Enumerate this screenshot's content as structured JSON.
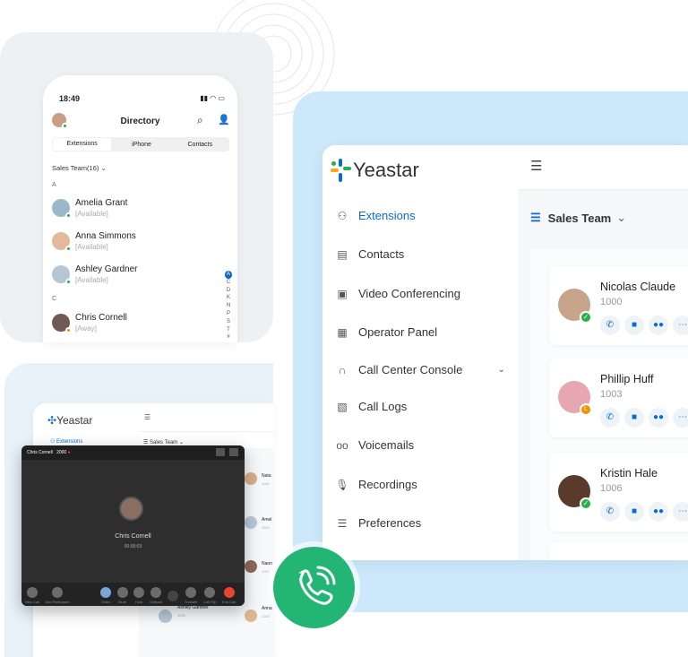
{
  "colors": {
    "accent": "#0b6bcb",
    "online": "#22b14c",
    "away": "#f39000",
    "call_green": "#22b573",
    "end_call": "#e8442f"
  },
  "phone": {
    "time": "18:49",
    "title": "Directory",
    "tabs": [
      "Extensions",
      "iPhone",
      "Contacts"
    ],
    "group": "Sales Team(16)",
    "sections": [
      {
        "letter": "A",
        "contacts": [
          {
            "name": "Amelia Grant",
            "status": "[Available]",
            "presence": "online"
          },
          {
            "name": "Anna  Simmons",
            "status": "[Available]",
            "presence": "online"
          },
          {
            "name": "Ashley Gardner",
            "status": "[Available]",
            "presence": "online"
          }
        ]
      },
      {
        "letter": "C",
        "contacts": [
          {
            "name": "Chris Cornell",
            "status": "[Away]",
            "presence": "away"
          }
        ]
      }
    ],
    "index": [
      "A",
      "C",
      "D",
      "K",
      "N",
      "P",
      "S",
      "T",
      "#"
    ]
  },
  "mini_app": {
    "brand": "Yeastar",
    "nav_item": "Extensions",
    "group": "Sales Team",
    "contacts": [
      {
        "name": "Nata",
        "ext": "1001"
      },
      {
        "name": "Amel",
        "ext": "1004"
      },
      {
        "name": "Naon",
        "ext": "1007"
      },
      {
        "name": "Anna",
        "ext": "1010"
      }
    ],
    "bottom_contact": {
      "name": "Ashley Gardner",
      "ext": "1009"
    }
  },
  "video_call": {
    "caller": "Chris Cornell",
    "ext": "2000",
    "name": "Chris Cornell",
    "timer": "00:00:03",
    "buttons": [
      "New Call",
      "Add Participant",
      "Video",
      "Mute",
      "Hold",
      "Dialpad",
      "",
      "Transfer",
      "Call Flip",
      "End Call"
    ]
  },
  "app": {
    "brand": "Yeastar",
    "nav": [
      {
        "label": "Extensions",
        "icon": "users-icon",
        "active": true
      },
      {
        "label": "Contacts",
        "icon": "contacts-icon"
      },
      {
        "label": "Video Conferencing",
        "icon": "video-conf-icon"
      },
      {
        "label": "Operator Panel",
        "icon": "operator-icon"
      },
      {
        "label": "Call Center Console",
        "icon": "headset-icon",
        "expandable": true
      },
      {
        "label": "Call Logs",
        "icon": "call-log-icon"
      },
      {
        "label": "Voicemails",
        "icon": "voicemail-icon"
      },
      {
        "label": "Recordings",
        "icon": "microphone-icon"
      },
      {
        "label": "Preferences",
        "icon": "preferences-icon"
      }
    ],
    "group": "Sales Team",
    "contacts": [
      {
        "name": "Nicolas Claude",
        "ext": "1000",
        "presence": "online"
      },
      {
        "name": "Phillip Huff",
        "ext": "1003",
        "presence": "away"
      },
      {
        "name": "Kristin Hale",
        "ext": "1006",
        "presence": "online"
      }
    ]
  }
}
